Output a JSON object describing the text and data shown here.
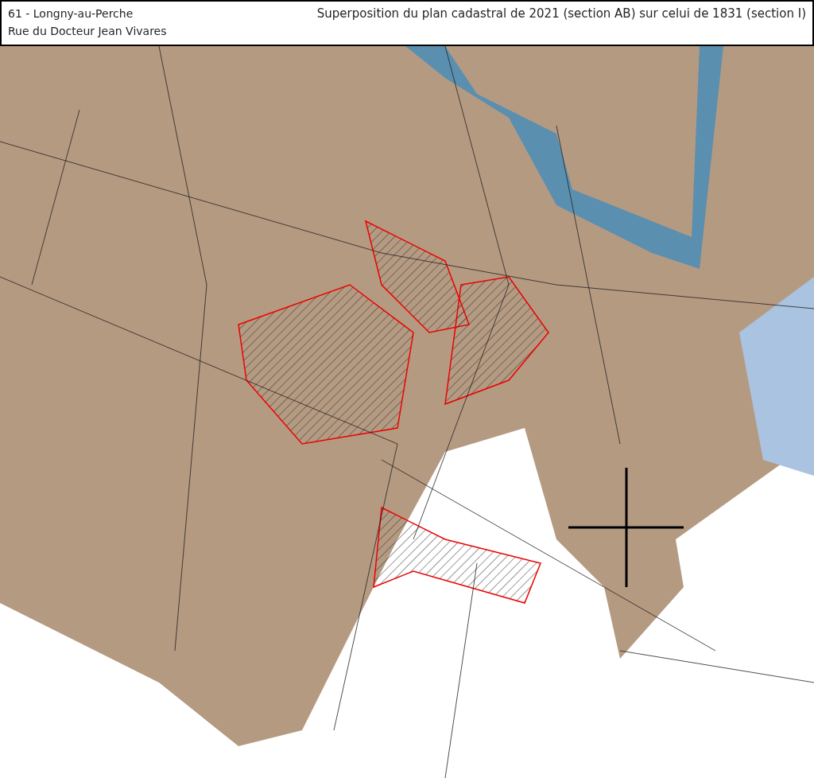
{
  "header": {
    "place_lines": [
      "61 - Longny-au-Perche",
      "Rue du Docteur Jean Vivares"
    ],
    "title": "Superposition du plan cadastral de 2021 (section AB) sur celui de 1831 (section I)"
  }
}
